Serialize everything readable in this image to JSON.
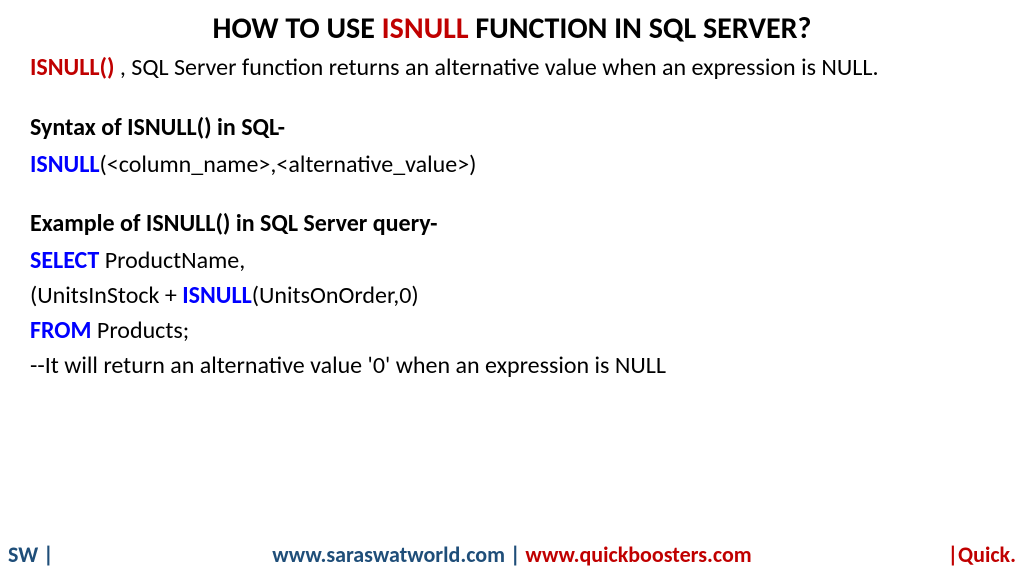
{
  "title": {
    "before": "HOW TO USE ",
    "highlight": "ISNULL",
    "after": " FUNCTION IN SQL SERVER?"
  },
  "desc": {
    "keyword": "ISNULL()",
    "rest": " , SQL Server function returns an alternative value when an expression is NULL."
  },
  "syntax": {
    "heading": "Syntax of ISNULL() in SQL-",
    "keyword": "ISNULL",
    "args": "(<column_name>,<alternative_value>)"
  },
  "example": {
    "heading": "Example of ISNULL() in SQL Server query-",
    "line1": {
      "kw": "SELECT",
      "rest": " ProductName,"
    },
    "line2": {
      "before": "(UnitsInStock + ",
      "kw": "ISNULL",
      "after": "(UnitsOnOrder,0)"
    },
    "line3": {
      "kw": "FROM",
      "rest": " Products;"
    },
    "line4": "--It will return an alternative value '0' when an expression is NULL"
  },
  "footer": {
    "left": "SW |",
    "centerBlue": "www.saraswatworld.com |",
    "centerRed": " www.quickboosters.com",
    "right": "|Quick."
  }
}
